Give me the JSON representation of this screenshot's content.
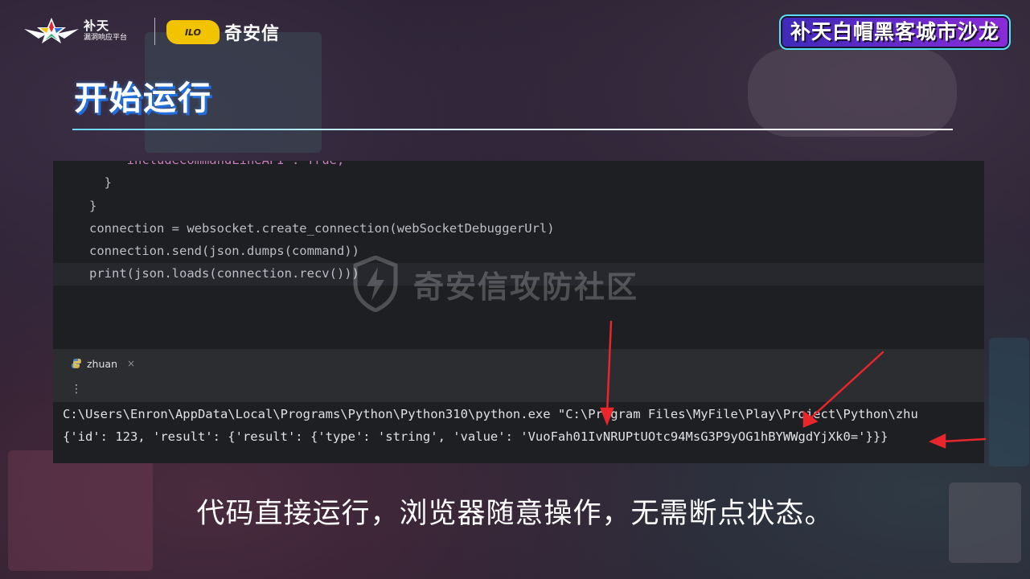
{
  "header": {
    "butian_name": "补天",
    "butian_sub": "漏洞响应平台",
    "qax_badge": "ILO",
    "qax_name": "奇安信",
    "event": "补天白帽黑客城市沙龙"
  },
  "slide": {
    "title": "开始运行",
    "caption": "代码直接运行，浏览器随意操作，无需断点状态。"
  },
  "code": {
    "lines": [
      "    \"includeCommandLineAPI\": True,",
      "  }",
      "}",
      "connection = websocket.create_connection(webSocketDebuggerUrl)",
      "connection.send(json.dumps(command))",
      "print(json.loads(connection.recv()))"
    ]
  },
  "watermark": "奇安信攻防社区",
  "run_panel": {
    "tab_label": "zhuan",
    "tab_close": "×",
    "menu_glyph": "⋮",
    "console": [
      "C:\\Users\\Enron\\AppData\\Local\\Programs\\Python\\Python310\\python.exe \"C:\\Program Files\\MyFile\\Play\\Project\\Python\\zhu",
      "{'id': 123, 'result': {'result': {'type': 'string', 'value': 'VuoFah01IvNRUPtUOtc94MsG3P9yOG1hBYWWgdYjXk0='}}}"
    ]
  },
  "colors": {
    "accent_red": "#e8262b",
    "brand_blue": "#1f6fe0",
    "qax_yellow": "#f2c300"
  }
}
